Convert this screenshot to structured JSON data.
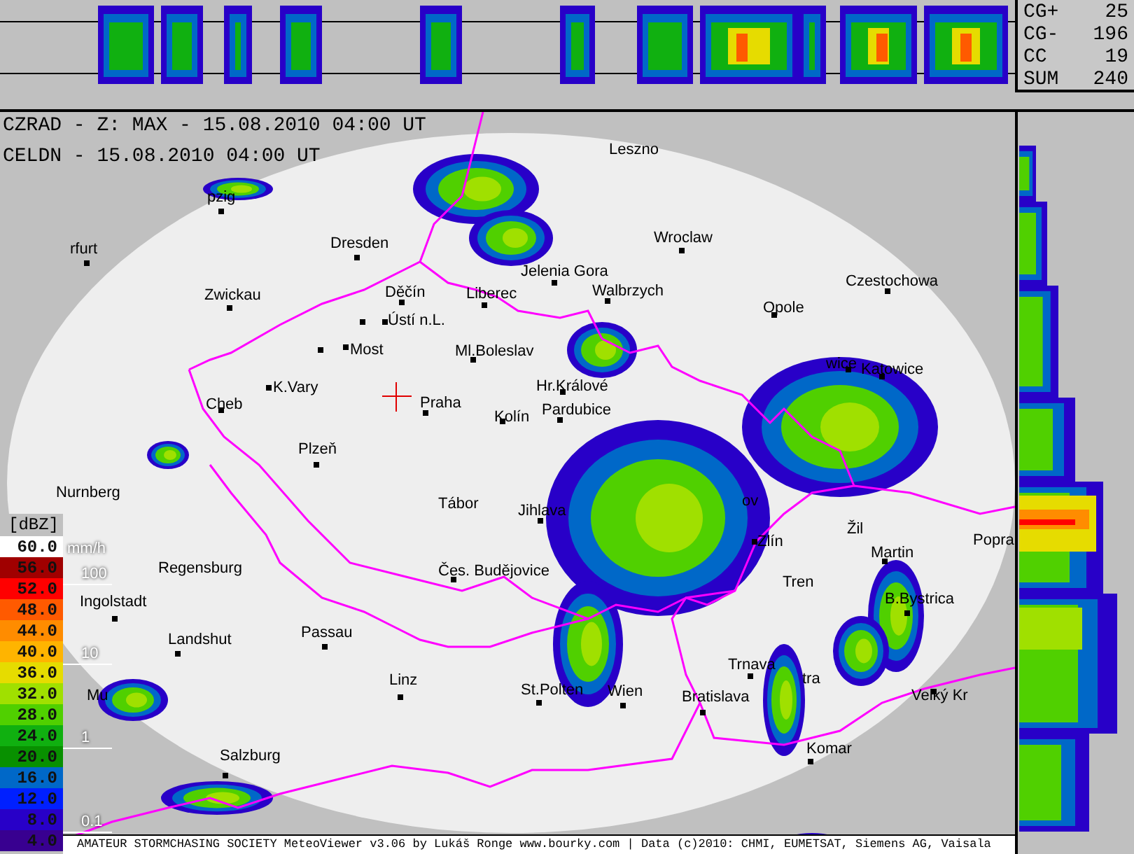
{
  "lightning_counts": [
    {
      "label": "CG+",
      "value": "25"
    },
    {
      "label": "CG-",
      "value": "196"
    },
    {
      "label": "CC",
      "value": "19"
    },
    {
      "label": "SUM",
      "value": "240"
    }
  ],
  "header": {
    "lines": [
      "CZRAD - Z: MAX - 15.08.2010 04:00 UT",
      "CELDN - 15.08.2010 04:00 UT"
    ]
  },
  "map": {
    "cities": [
      {
        "name": "Leszno",
        "marker": false
      },
      {
        "name": "pzig",
        "marker": true
      },
      {
        "name": "rfurt",
        "marker": true
      },
      {
        "name": "Dresden",
        "marker": true
      },
      {
        "name": "Wroclaw",
        "marker": true
      },
      {
        "name": "Jelenia Gora",
        "marker": true
      },
      {
        "name": "Czestochowa",
        "marker": true
      },
      {
        "name": "Zwickau",
        "marker": true
      },
      {
        "name": "Děčín",
        "marker": true
      },
      {
        "name": "Liberec",
        "marker": true
      },
      {
        "name": "Walbrzych",
        "marker": true
      },
      {
        "name": "Opole",
        "marker": true
      },
      {
        "name": "Ústí n.L.",
        "marker": true
      },
      {
        "name": "Most",
        "marker": true
      },
      {
        "name": "Ml.Boleslav",
        "marker": true
      },
      {
        "name": "wice",
        "marker": true
      },
      {
        "name": "Katowice",
        "marker": true
      },
      {
        "name": "K.Vary",
        "marker": true
      },
      {
        "name": "Hr.Králové",
        "marker": true
      },
      {
        "name": "Cheb",
        "marker": true
      },
      {
        "name": "Praha",
        "marker": true
      },
      {
        "name": "Kolín",
        "marker": true
      },
      {
        "name": "Pardubice",
        "marker": true
      },
      {
        "name": "Plzeň",
        "marker": true
      },
      {
        "name": "Nurnberg",
        "marker": false
      },
      {
        "name": "Tábor",
        "marker": false
      },
      {
        "name": "Jihlava",
        "marker": true
      },
      {
        "name": "ov",
        "marker": false
      },
      {
        "name": "Zlín",
        "marker": true
      },
      {
        "name": "Žil",
        "marker": false
      },
      {
        "name": "Martin",
        "marker": true
      },
      {
        "name": "Popra",
        "marker": false
      },
      {
        "name": "Regensburg",
        "marker": false
      },
      {
        "name": "Čes. Budějovice",
        "marker": true
      },
      {
        "name": "Tren",
        "marker": false
      },
      {
        "name": "Ingolstadt",
        "marker": true
      },
      {
        "name": "B.Bystrica",
        "marker": true
      },
      {
        "name": "Landshut",
        "marker": true
      },
      {
        "name": "Passau",
        "marker": true
      },
      {
        "name": "Trnava",
        "marker": true
      },
      {
        "name": "tra",
        "marker": false
      },
      {
        "name": "Mu",
        "marker": false
      },
      {
        "name": "Linz",
        "marker": true
      },
      {
        "name": "St.Polten",
        "marker": true
      },
      {
        "name": "Wien",
        "marker": true
      },
      {
        "name": "Bratislava",
        "marker": true
      },
      {
        "name": "Velký Kr",
        "marker": true
      },
      {
        "name": "Salzburg",
        "marker": true
      },
      {
        "name": "Komar",
        "marker": true
      }
    ]
  },
  "legend": {
    "title": "[dBZ]",
    "levels": [
      {
        "label": "60.0",
        "color": "#ffffff"
      },
      {
        "label": "56.0",
        "color": "#a00000"
      },
      {
        "label": "52.0",
        "color": "#ff0000"
      },
      {
        "label": "48.0",
        "color": "#ff5a00"
      },
      {
        "label": "44.0",
        "color": "#ff8c00"
      },
      {
        "label": "40.0",
        "color": "#ffb400"
      },
      {
        "label": "36.0",
        "color": "#e6dc00"
      },
      {
        "label": "32.0",
        "color": "#a0e000"
      },
      {
        "label": "28.0",
        "color": "#50d000"
      },
      {
        "label": "24.0",
        "color": "#10b010"
      },
      {
        "label": "20.0",
        "color": "#089000"
      },
      {
        "label": "16.0",
        "color": "#0068c8"
      },
      {
        "label": "12.0",
        "color": "#0020ff"
      },
      {
        "label": "8.0",
        "color": "#2800c8"
      },
      {
        "label": "4.0",
        "color": "#380090"
      }
    ],
    "rain_unit": "mm/h",
    "rain_marks": [
      "100",
      "10",
      "1",
      "0.1"
    ]
  },
  "footer": {
    "credit": "AMATEUR STORMCHASING SOCIETY MeteoViewer v3.06 by Lukáš Ronge www.bourky.com | Data (c)2010: CHMI, EUMETSAT, Siemens AG, Vaisala"
  }
}
